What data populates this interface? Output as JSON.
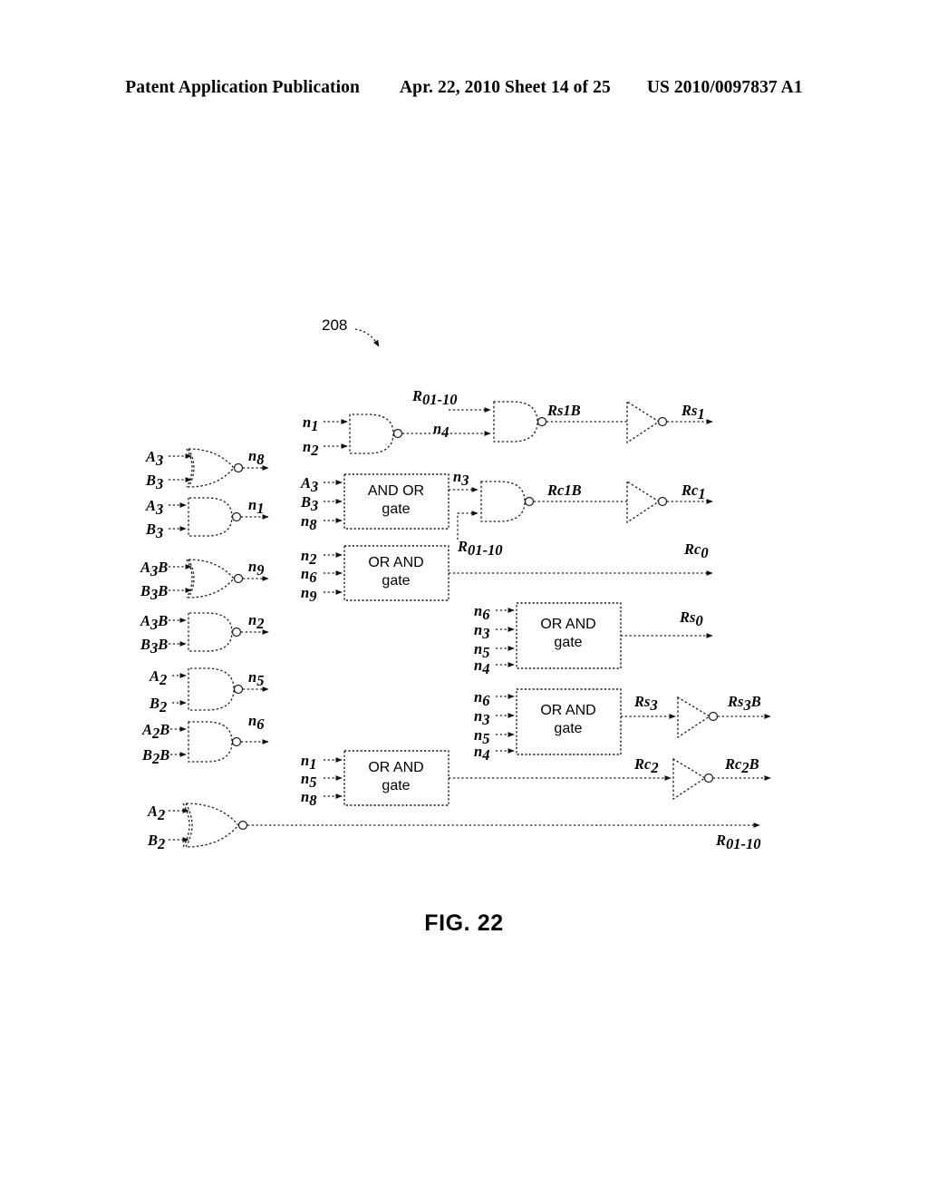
{
  "header": {
    "publication": "Patent Application Publication",
    "date_sheet": "Apr. 22, 2010  Sheet 14 of 25",
    "patent_number": "US 2010/0097837 A1"
  },
  "figure": {
    "caption": "FIG. 22",
    "reference_numeral": "208"
  },
  "labels": {
    "A3": "A",
    "A3sub": "3",
    "B3": "B",
    "B3sub": "3",
    "A3B": "A",
    "A3Bsub": "3",
    "A3Btail": "B",
    "B3B": "B",
    "B3Bsub": "3",
    "B3Btail": "B",
    "A2": "A",
    "A2sub": "2",
    "B2": "B",
    "B2sub": "2",
    "A2B": "A",
    "A2Bsub": "2",
    "A2Btail": "B",
    "B2B": "B",
    "B2Bsub": "2",
    "B2Btail": "B",
    "n1": "n",
    "n1sub": "1",
    "n2": "n",
    "n2sub": "2",
    "n3": "n",
    "n3sub": "3",
    "n4": "n",
    "n4sub": "4",
    "n5": "n",
    "n5sub": "5",
    "n6": "n",
    "n6sub": "6",
    "n8": "n",
    "n8sub": "8",
    "n9": "n",
    "n9sub": "9",
    "R0110": "R",
    "R0110sub": "01-10",
    "Rs1B": "Rs1B",
    "Rs1": "Rs",
    "Rs1sub": "1",
    "Rc1B": "Rc1B",
    "Rc1": "Rc",
    "Rc1sub": "1",
    "Rc0": "Rc",
    "Rc0sub": "0",
    "Rs0": "Rs",
    "Rs0sub": "0",
    "Rs3": "Rs",
    "Rs3sub": "3",
    "Rs3B_main": "Rs",
    "Rs3B_sub": "3",
    "Rs3B_tail": "B",
    "Rc2": "Rc",
    "Rc2sub": "2",
    "Rc2B_main": "Rc",
    "Rc2B_sub": "2",
    "Rc2B_tail": "B"
  },
  "blocks": [
    {
      "id": "and-or-gate",
      "line1": "AND OR",
      "line2": "gate",
      "inputs": [
        "A3",
        "B3",
        "n8"
      ],
      "output": "n3"
    },
    {
      "id": "or-and-gate-rc0",
      "line1": "OR AND",
      "line2": "gate",
      "inputs": [
        "n2",
        "n6",
        "n9"
      ],
      "output": "Rc0"
    },
    {
      "id": "or-and-gate-rs0",
      "line1": "OR AND",
      "line2": "gate",
      "inputs": [
        "n6",
        "n3",
        "n5",
        "n4"
      ],
      "output": "Rs0"
    },
    {
      "id": "or-and-gate-rs3",
      "line1": "OR AND",
      "line2": "gate",
      "inputs": [
        "n6",
        "n3",
        "n5",
        "n4"
      ],
      "output": "Rs3"
    },
    {
      "id": "or-and-gate-rc2",
      "line1": "OR AND",
      "line2": "gate",
      "inputs": [
        "n1",
        "n5",
        "n8"
      ],
      "output": "Rc2"
    }
  ],
  "gates": [
    {
      "id": "nor-n8",
      "type": "NOR",
      "inputs": [
        "A3",
        "B3"
      ],
      "output": "n8"
    },
    {
      "id": "nand-n1",
      "type": "NAND",
      "inputs": [
        "A3",
        "B3"
      ],
      "output": "n1"
    },
    {
      "id": "nor-n9",
      "type": "NOR",
      "inputs": [
        "A3B",
        "B3B"
      ],
      "output": "n9"
    },
    {
      "id": "nand-n2",
      "type": "NAND",
      "inputs": [
        "A3B",
        "B3B"
      ],
      "output": "n2"
    },
    {
      "id": "nand-n5",
      "type": "NAND",
      "inputs": [
        "A2",
        "B2"
      ],
      "output": "n5"
    },
    {
      "id": "nand-n6",
      "type": "NAND",
      "inputs": [
        "A2B",
        "B2B"
      ],
      "output": "n6"
    },
    {
      "id": "nor-r0110",
      "type": "NOR",
      "inputs": [
        "A2",
        "B2"
      ],
      "output": "R0110"
    },
    {
      "id": "nand-n4",
      "type": "NAND",
      "inputs": [
        "n1",
        "n2"
      ],
      "output": "n4"
    },
    {
      "id": "nand-rs1b",
      "type": "NAND",
      "inputs": [
        "R0110",
        "n4"
      ],
      "output": "Rs1B"
    },
    {
      "id": "nand-rc1b",
      "type": "NAND",
      "inputs": [
        "n3",
        "R0110"
      ],
      "output": "Rc1B"
    }
  ],
  "inverters": [
    {
      "id": "inv-rs1",
      "input": "Rs1B",
      "output": "Rs1"
    },
    {
      "id": "inv-rc1",
      "input": "Rc1B",
      "output": "Rc1"
    },
    {
      "id": "inv-rs3b",
      "input": "Rs3",
      "output": "Rs3B"
    },
    {
      "id": "inv-rc2b",
      "input": "Rc2",
      "output": "Rc2B"
    }
  ],
  "colors": {
    "ink": "#1a1a1a",
    "paper": "#ffffff"
  }
}
